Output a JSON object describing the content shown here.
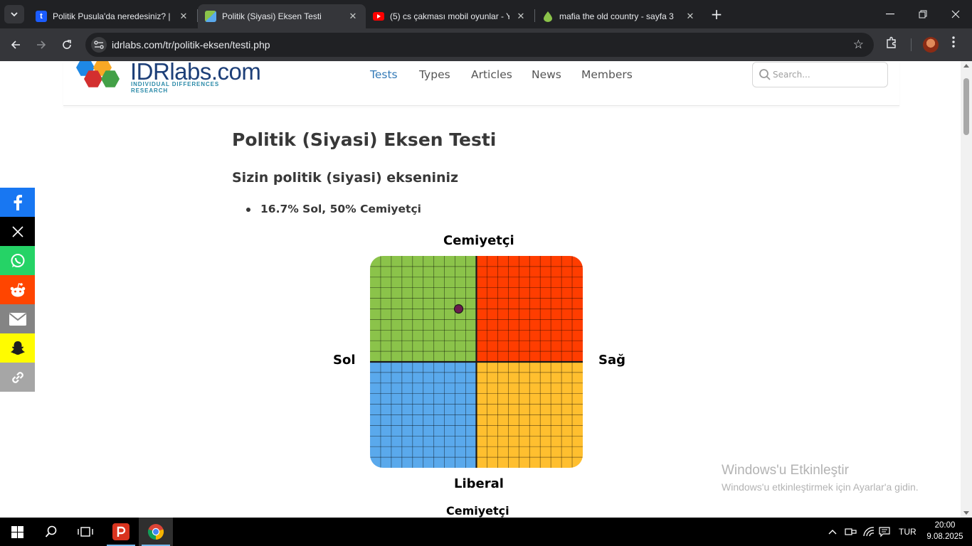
{
  "browser": {
    "tabs": [
      {
        "title": "Politik Pusula'da neredesiniz? | ",
        "favicon": "tumblr-t-icon",
        "active": false
      },
      {
        "title": "Politik (Siyasi) Eksen Testi",
        "favicon": "idrlabs-icon",
        "active": true
      },
      {
        "title": "(5) cs çakması mobil oyunlar - Y",
        "favicon": "youtube-icon",
        "active": false
      },
      {
        "title": "mafia the old country - sayfa 3",
        "favicon": "drop-icon",
        "active": false
      }
    ],
    "url": "idrlabs.com/tr/politik-eksen/testi.php"
  },
  "site": {
    "logo": {
      "brand": "IDRlabs",
      "tld": ".com",
      "tagline": "INDIVIDUAL DIFFERENCES RESEARCH"
    },
    "nav": [
      "Tests",
      "Types",
      "Articles",
      "News",
      "Members"
    ],
    "active_nav": "Tests",
    "search_placeholder": "Search..."
  },
  "content": {
    "title": "Politik (Siyasi) Eksen Testi",
    "subtitle": "Sizin politik (siyasi) ekseniniz",
    "result": "16.7% Sol, 50% Cemiyetçi",
    "axis_top": "Cemiyetçi",
    "axis_bottom": "Liberal",
    "axis_left": "Sol",
    "axis_right": "Sağ",
    "next_heading": "Cemiyetçi"
  },
  "chart_data": {
    "type": "scatter",
    "x_axis": {
      "min": -100,
      "max": 100,
      "left_label": "Sol",
      "right_label": "Sağ"
    },
    "y_axis": {
      "min": -100,
      "max": 100,
      "top_label": "Cemiyetçi",
      "bottom_label": "Liberal"
    },
    "grid_divisions": 20,
    "quadrant_colors": {
      "top_left": "#8bc34a",
      "top_right": "#ff3d00",
      "bottom_left": "#5aa9ec",
      "bottom_right": "#ffbf2f"
    },
    "point": {
      "x": -16.7,
      "y": 50,
      "color": "#6a1b4d"
    }
  },
  "share": [
    "facebook-icon",
    "x-icon",
    "whatsapp-icon",
    "reddit-icon",
    "email-icon",
    "snapchat-icon",
    "link-icon"
  ],
  "watermark": {
    "line1": "Windows'u Etkinleştir",
    "line2": "Windows'u etkinleştirmek için Ayarlar'a gidin."
  },
  "taskbar": {
    "language": "TUR",
    "time": "20:00",
    "date": "9.08.2025"
  }
}
